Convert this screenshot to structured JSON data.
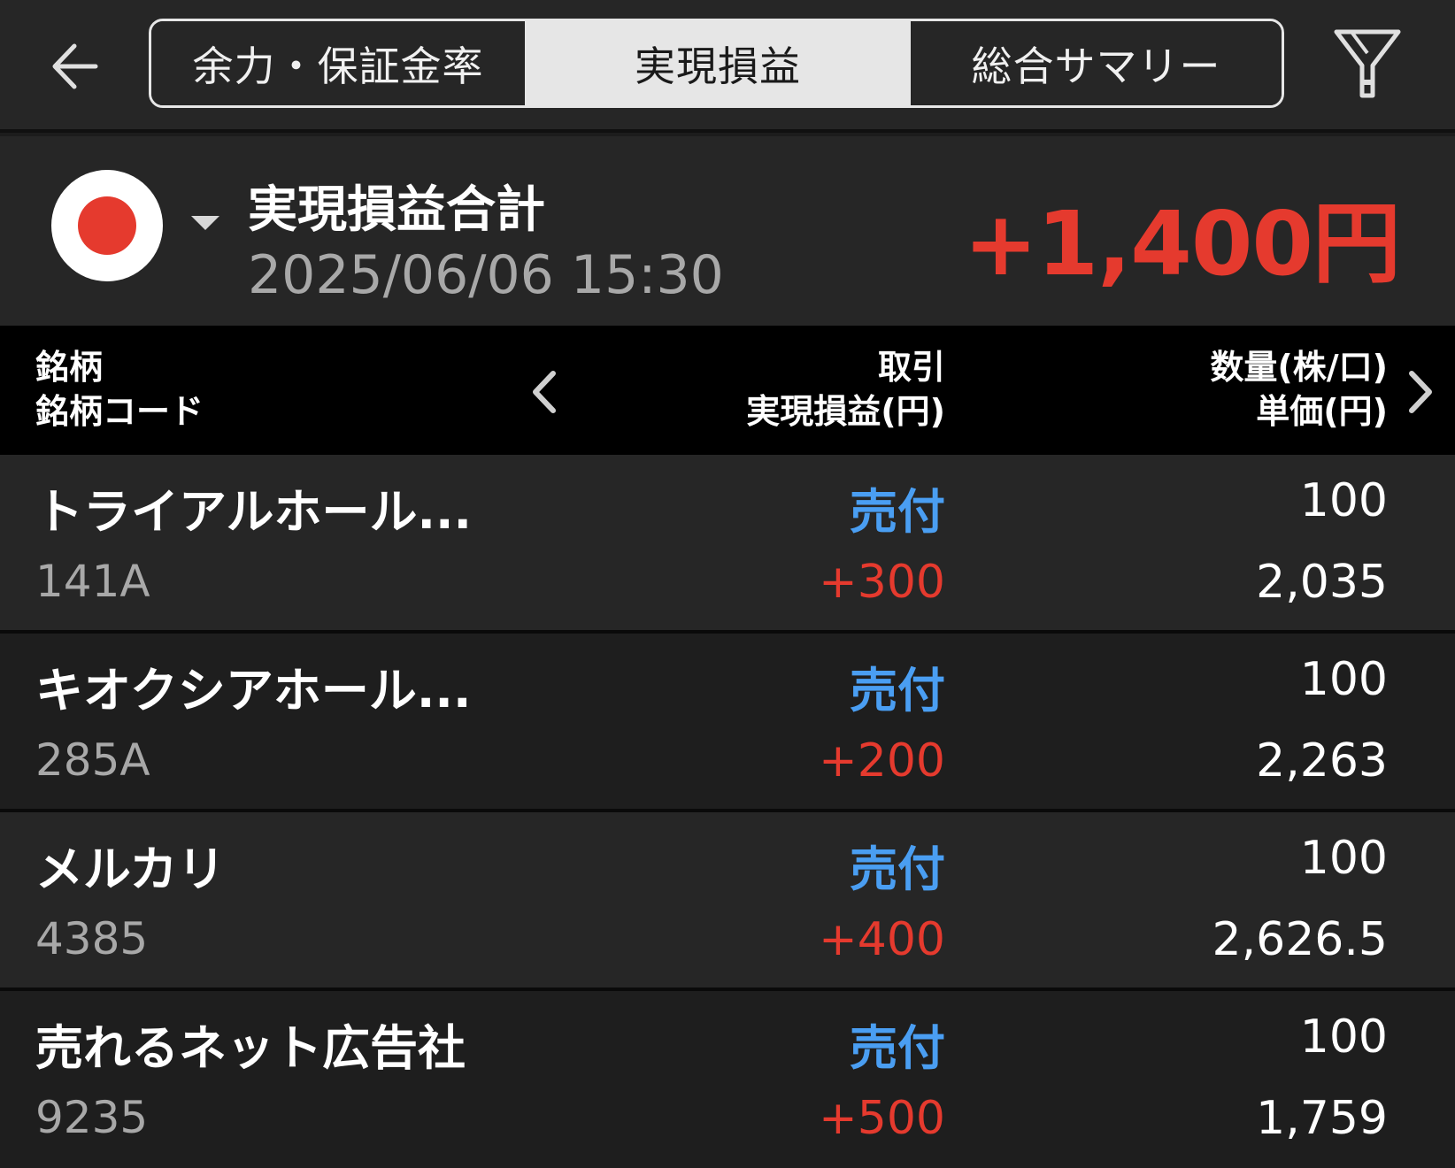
{
  "header": {
    "tabs": [
      {
        "label": "余力・保証金率"
      },
      {
        "label": "実現損益"
      },
      {
        "label": "総合サマリー"
      }
    ]
  },
  "summary": {
    "title": "実現損益合計",
    "datetime": "2025/06/06  15:30",
    "total": "+1,400円"
  },
  "table": {
    "col1": {
      "line1": "銘柄",
      "line2": "銘柄コード"
    },
    "col2": {
      "line1": "取引",
      "line2": "実現損益(円)"
    },
    "col3": {
      "line1": "数量(株/口)",
      "line2": "単価(円)"
    },
    "rows": [
      {
        "name": "トライアルホール...",
        "code": "141A",
        "trade": "売付",
        "pnl": "+300",
        "qty": "100",
        "price": "2,035"
      },
      {
        "name": "キオクシアホール...",
        "code": "285A",
        "trade": "売付",
        "pnl": "+200",
        "qty": "100",
        "price": "2,263"
      },
      {
        "name": "メルカリ",
        "code": "4385",
        "trade": "売付",
        "pnl": "+400",
        "qty": "100",
        "price": "2,626.5"
      },
      {
        "name": "売れるネット広告社",
        "code": "9235",
        "trade": "売付",
        "pnl": "+500",
        "qty": "100",
        "price": "1,759"
      }
    ]
  },
  "colors": {
    "accent_red": "#e53a2e",
    "accent_blue": "#4a9ef2",
    "background": "#1c1c1c"
  },
  "icons": [
    "back-arrow-icon",
    "filter-icon",
    "japan-flag-icon",
    "caret-down-icon",
    "chevron-left-icon",
    "chevron-right-icon"
  ]
}
